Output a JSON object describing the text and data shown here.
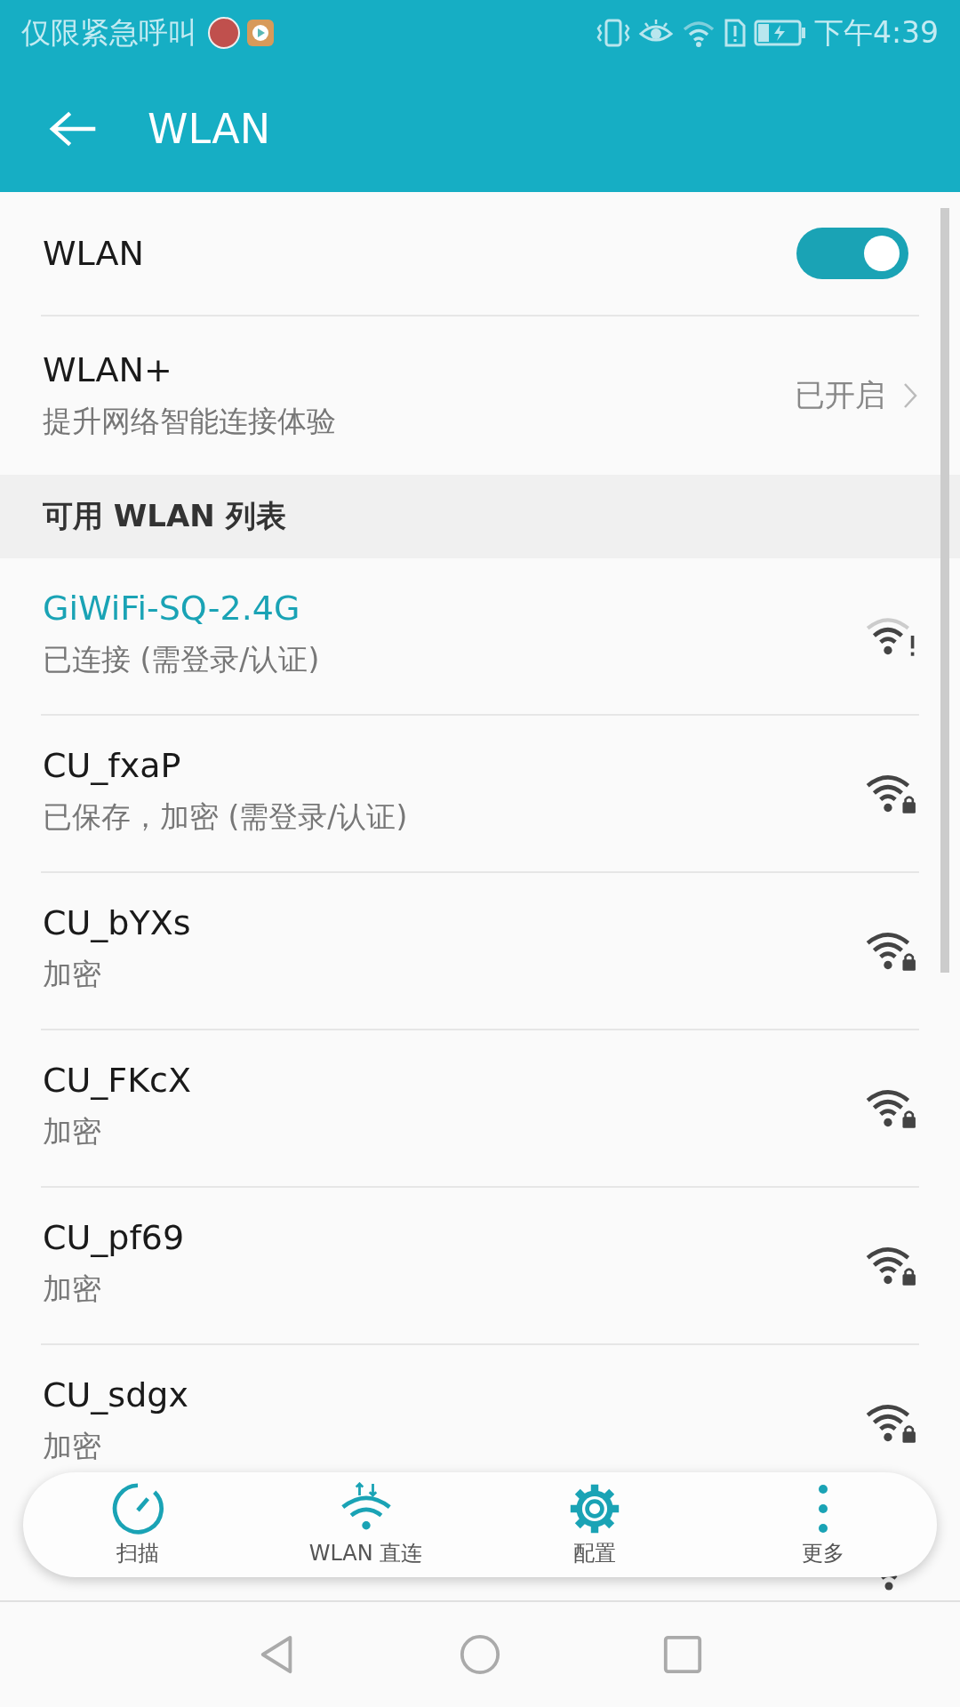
{
  "status_bar": {
    "carrier": "仅限紧急呼叫",
    "time": "下午4:39"
  },
  "header": {
    "title": "WLAN"
  },
  "wlan_switch": {
    "label": "WLAN",
    "on": true
  },
  "wlan_plus": {
    "title": "WLAN+",
    "subtitle": "提升网络智能连接体验",
    "value": "已开启"
  },
  "section": {
    "title": "可用 WLAN 列表"
  },
  "networks": [
    {
      "name": "GiWiFi-SQ-2.4G",
      "status": "已连接 (需登录/认证)",
      "connected": true,
      "kind": "alert"
    },
    {
      "name": "CU_fxaP",
      "status": "已保存，加密 (需登录/认证)",
      "connected": false,
      "kind": "lock"
    },
    {
      "name": "CU_bYXs",
      "status": "加密",
      "connected": false,
      "kind": "lock"
    },
    {
      "name": "CU_FKcX",
      "status": "加密",
      "connected": false,
      "kind": "lock"
    },
    {
      "name": "CU_pf69",
      "status": "加密",
      "connected": false,
      "kind": "lock"
    },
    {
      "name": "CU_sdgx",
      "status": "加密",
      "connected": false,
      "kind": "lock"
    },
    {
      "kind": "open"
    }
  ],
  "toolbar": [
    {
      "label": "扫描",
      "kind": "scan"
    },
    {
      "label": "WLAN 直连",
      "kind": "direct"
    },
    {
      "label": "配置",
      "kind": "settings"
    },
    {
      "label": "更多",
      "kind": "more"
    }
  ]
}
